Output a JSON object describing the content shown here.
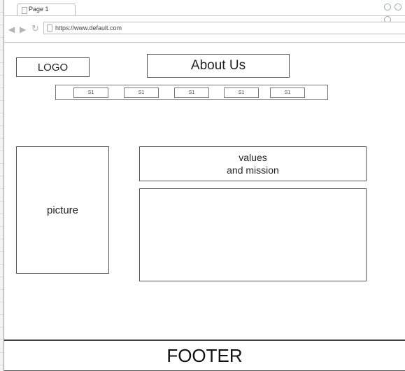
{
  "browser": {
    "tab_title": "Page 1",
    "url": "https://www.default.com",
    "nav_icons": [
      "back-arrow-icon",
      "forward-arrow-icon",
      "reload-icon"
    ]
  },
  "header": {
    "logo": "LOGO",
    "page_title": "About Us"
  },
  "nav": {
    "items": [
      "S1",
      "S1",
      "S1",
      "S1",
      "S1"
    ]
  },
  "content": {
    "picture_label": "picture",
    "values_line1": "values",
    "values_line2": "and mission"
  },
  "footer": {
    "label": "FOOTER"
  }
}
